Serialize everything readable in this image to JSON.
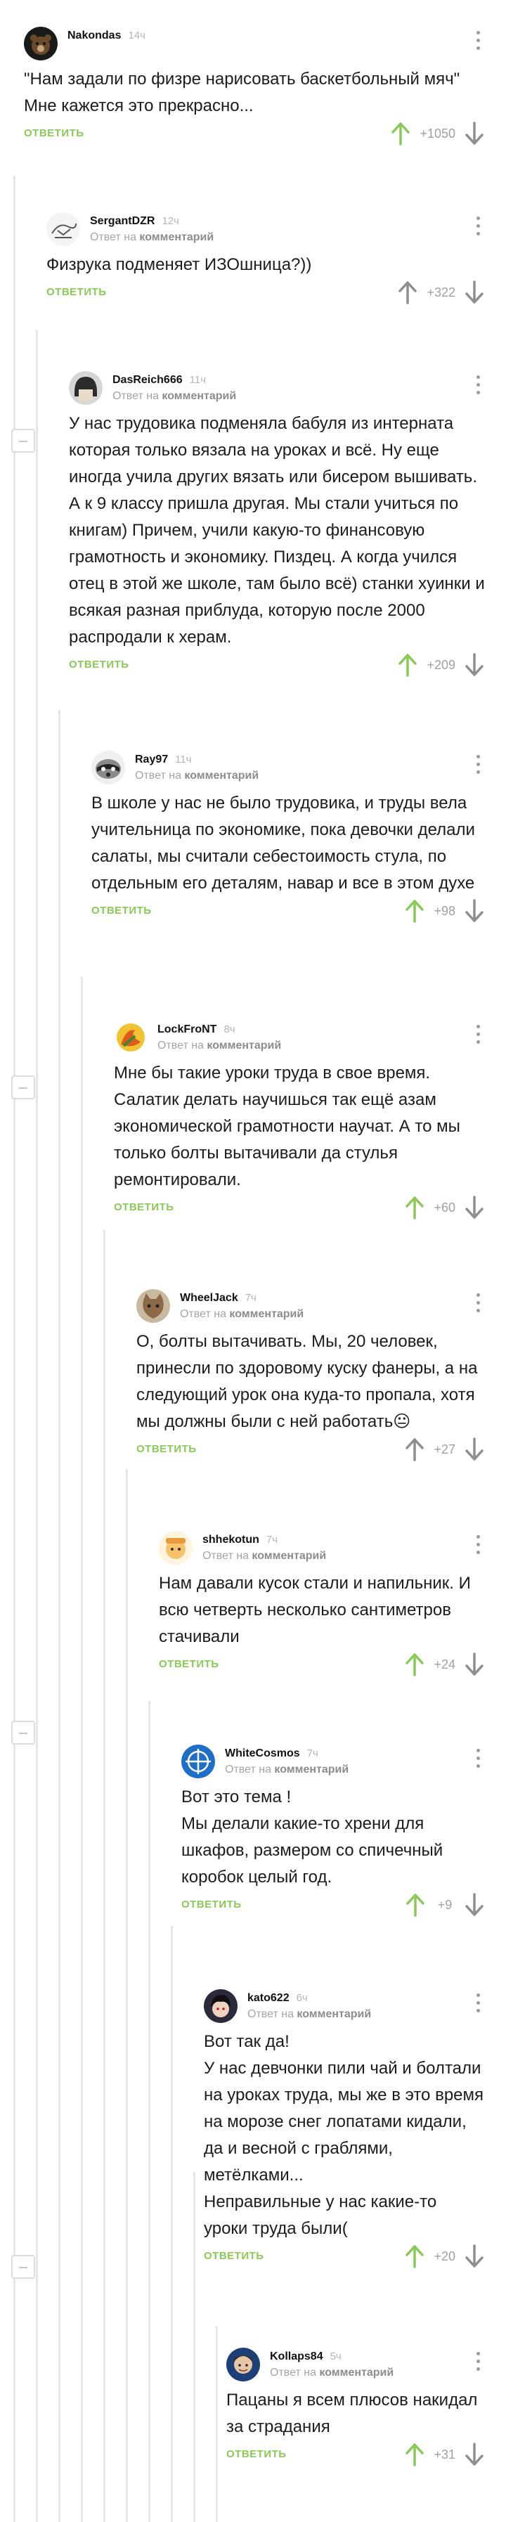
{
  "colors": {
    "accent": "#8ac858",
    "muted": "#a5a5a5",
    "line": "#e6e6e6",
    "text": "#1c1c1c"
  },
  "reply_label": "ОТВЕТИТЬ",
  "comments": [
    {
      "author": "Nakondas",
      "time": "14ч",
      "meta": "",
      "text": "\"Нам задали по физре нарисовать баскетбольный мяч\"\nМне кажется это прекрасно...",
      "rating": "+1050",
      "voted_up": true,
      "avatar_icon": "bear-avatar-icon"
    },
    {
      "author": "SergantDZR",
      "time": "12ч",
      "meta": {
        "prefix": "Ответ на ",
        "link": "комментарий"
      },
      "text": "Физрука подменяет ИЗОшница?))",
      "rating": "+322",
      "voted_up": false,
      "avatar_icon": "sketch-avatar-icon"
    },
    {
      "author": "DasReich666",
      "time": "11ч",
      "meta": {
        "prefix": "Ответ на ",
        "link": "комментарий"
      },
      "text": "У нас трудовика подменяла бабуля из интерната которая только вязала на уроках и всё. Ну еще иногда учила других вязать или бисером вышивать. А к 9 классу пришла другая. Мы стали учиться по книгам) Причем, учили какую-то финансовую грамотность и экономику. Пиздец. А когда учился отец в этой же школе, там было всё) станки хуинки и всякая разная приблуда, которую после 2000 распродали к херам.",
      "rating": "+209",
      "voted_up": true,
      "avatar_icon": "helmet-avatar-icon"
    },
    {
      "author": "Ray97",
      "time": "11ч",
      "meta": {
        "prefix": "Ответ на ",
        "link": "комментарий"
      },
      "text": "В школе у нас не было трудовика, и труды вела учительница по экономике, пока девочки делали салаты, мы считали себестоимость стула, по отдельным его деталям, навар и все в этом духе",
      "rating": "+98",
      "voted_up": true,
      "avatar_icon": "raccoon-avatar-icon"
    },
    {
      "author": "LockFroNT",
      "time": "8ч",
      "meta": {
        "prefix": "Ответ на ",
        "link": "комментарий"
      },
      "text": "Мне бы такие уроки труда в свое время. Салатик делать научишься так ещё азам экономической грамотности научат. А то мы только болты вытачивали да стулья ремонтировали.",
      "rating": "+60",
      "voted_up": true,
      "avatar_icon": "flame-avatar-icon"
    },
    {
      "author": "WheelJack",
      "time": "7ч",
      "meta": {
        "prefix": "Ответ на ",
        "link": "комментарий"
      },
      "text": "О, болты вытачивать. Мы, 20 человек, принесли по здоровому куску фанеры, а на следующий урок она куда-то пропала, хотя мы должны были с ней работать😐",
      "rating": "+27",
      "voted_up": false,
      "avatar_icon": "cat-avatar-icon"
    },
    {
      "author": "shhekotun",
      "time": "7ч",
      "meta": {
        "prefix": "Ответ на ",
        "link": "комментарий"
      },
      "text": "Нам давали кусок стали и напильник. И всю четверть несколько сантиметров стачивали",
      "rating": "+24",
      "voted_up": true,
      "avatar_icon": "cartoon-avatar-icon"
    },
    {
      "author": "WhiteCosmos",
      "time": "7ч",
      "meta": {
        "prefix": "Ответ на ",
        "link": "комментарий"
      },
      "text": "Вот это тема !\nМы делали какие-то хрени для шкафов, размером со спичечный коробок целый год.",
      "rating": "+9",
      "voted_up": true,
      "avatar_icon": "crosshair-avatar-icon"
    },
    {
      "author": "kato622",
      "time": "6ч",
      "meta": {
        "prefix": "Ответ на ",
        "link": "комментарий"
      },
      "text": "Вот так да!\nУ нас девчонки пили чай и болтали на уроках труда, мы же в это время на морозе снег лопатами кидали, да и весной с граблями, метёлками...\nНеправильные у нас какие-то уроки труда были(",
      "rating": "+20",
      "voted_up": true,
      "avatar_icon": "anime-avatar-icon"
    },
    {
      "author": "Kollaps84",
      "time": "5ч",
      "meta": {
        "prefix": "Ответ на ",
        "link": "комментарий"
      },
      "text": "Пацаны я всем плюсов накидал за страдания",
      "rating": "+31",
      "voted_up": true,
      "avatar_icon": "face-avatar-icon"
    }
  ]
}
